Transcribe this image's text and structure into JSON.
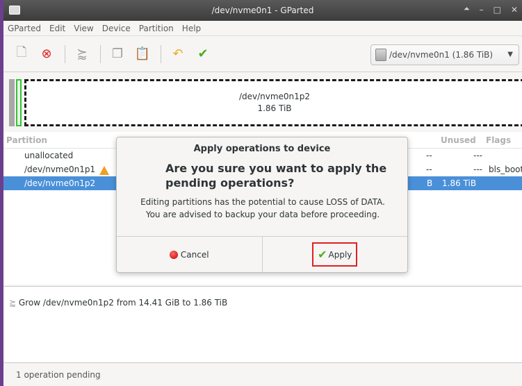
{
  "window": {
    "title": "/dev/nvme0n1 - GParted"
  },
  "menu": [
    "GParted",
    "Edit",
    "View",
    "Device",
    "Partition",
    "Help"
  ],
  "toolbar": {
    "device": "/dev/nvme0n1  (1.86 TiB)"
  },
  "diskmap": {
    "name": "/dev/nvme0n1p2",
    "size": "1.86 TiB"
  },
  "columns": {
    "partition": "Partition",
    "unused": "Unused",
    "flags": "Flags"
  },
  "rows": [
    {
      "partition": "unallocated",
      "used": "--",
      "unused": "---",
      "flags": ""
    },
    {
      "partition": "/dev/nvme0n1p1",
      "used": "--",
      "unused": "---",
      "flags": "bls_boot"
    },
    {
      "partition": "/dev/nvme0n1p2",
      "used": "B",
      "unused": "1.86 TiB",
      "flags": ""
    }
  ],
  "dialog": {
    "title": "Apply operations to device",
    "primary": "Are you sure you want to apply the pending operations?",
    "secondary_1": "Editing partitions has the potential to cause LOSS of DATA.",
    "secondary_2": "You are advised to backup your data before proceeding.",
    "cancel": "Cancel",
    "apply": "Apply"
  },
  "operations": [
    "Grow /dev/nvme0n1p2 from 14.41 GiB to 1.86 TiB"
  ],
  "status": "1 operation pending"
}
